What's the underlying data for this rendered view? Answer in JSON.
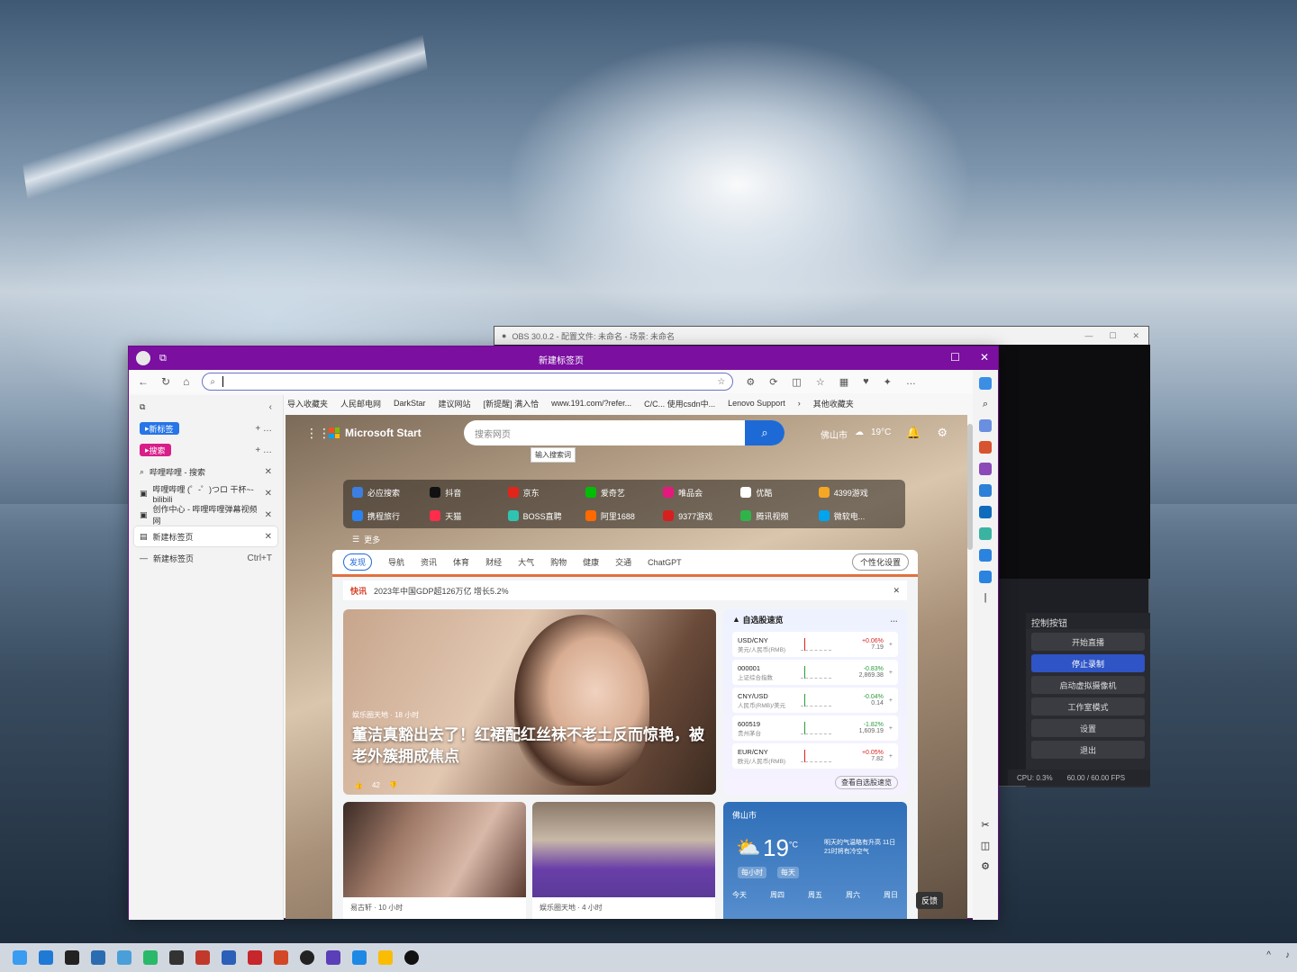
{
  "obs": {
    "title": "OBS 30.0.2 - 配置文件: 未命名 - 场景: 未命名",
    "controls_title": "控制按钮",
    "buttons": [
      "开始直播",
      "停止录制",
      "启动虚拟摄像机",
      "工作室模式",
      "设置",
      "退出"
    ],
    "status_cpu": "CPU: 0.3%",
    "status_fps": "60.00 / 60.00 FPS"
  },
  "browser": {
    "tab_title": "新建标签页",
    "address_value": "",
    "bookmarks": [
      "导入收藏夹",
      "人民邮电网",
      "DarkStar",
      "建议网站",
      "[新提醒] 满入恰",
      "www.191.com/?refer...",
      "C/C... 使用csdn中...",
      "Lenovo Support",
      "其他收藏夹"
    ],
    "side_tabs": {
      "group1": "新标签",
      "group2": "搜索",
      "tabs": [
        {
          "title": "哔哩哔哩 - 搜索"
        },
        {
          "title": "哔哩哔哩 (゜-゜)つロ 干杯~-bilibili"
        },
        {
          "title": "创作中心 - 哔哩哔哩弹幕视频网"
        },
        {
          "title": "新建标签页"
        }
      ],
      "new_tab_label": "新建标签页",
      "new_tab_shortcut": "Ctrl+T"
    }
  },
  "msn": {
    "brand": "Microsoft Start",
    "search_placeholder": "搜索网页",
    "tooltip": "输入搜索词",
    "location": "佛山市",
    "temp_top": "19°C",
    "notif_count": "1",
    "quicklinks": [
      "必应搜索",
      "抖音",
      "京东",
      "爱奇艺",
      "唯品会",
      "优酷",
      "4399游戏",
      "携程旅行",
      "天猫",
      "BOSS直聘",
      "阿里1688",
      "9377游戏",
      "腾讯视频",
      "微软电...",
      "更多"
    ],
    "feed_tabs": [
      "发现",
      "导航",
      "资讯",
      "体育",
      "财经",
      "大气",
      "购物",
      "健康",
      "交通",
      "ChatGPT"
    ],
    "personalize": "个性化设置",
    "flash_tag": "快讯",
    "flash_text": "2023年中国GDP超126万亿 增长5.2%",
    "hero": {
      "source": "娱乐圈天地 · 18 小时",
      "title": "董洁真豁出去了！红裙配红丝袜不老土反而惊艳，被老外簇拥成焦点",
      "likes": "42"
    },
    "stocks": {
      "title": "自选股速览",
      "rows": [
        {
          "code": "USD/CNY",
          "name": "美元/人民币(RMB)",
          "chg": "+0.06%",
          "price": "7.19",
          "up": false
        },
        {
          "code": "000001",
          "name": "上证综合指数",
          "chg": "-0.83%",
          "price": "2,869.38",
          "up": true
        },
        {
          "code": "CNY/USD",
          "name": "人民币(RMB)/美元",
          "chg": "-0.04%",
          "price": "0.14",
          "up": true
        },
        {
          "code": "600519",
          "name": "贵州茅台",
          "chg": "-1.82%",
          "price": "1,609.19",
          "up": true
        },
        {
          "code": "EUR/CNY",
          "name": "欧元/人民币(RMB)",
          "chg": "+0.05%",
          "price": "7.82",
          "up": false
        }
      ],
      "footer": "查看自选股速览"
    },
    "cards": [
      {
        "source": "易古轩 · 10 小时"
      },
      {
        "source": "娱乐圈天地 · 4 小时"
      }
    ],
    "weather": {
      "city": "佛山市",
      "temp": "19",
      "unit": "°C",
      "note": "明天的气温略有升高 11日21时将有冷空气",
      "tab1": "每小时",
      "tab2": "每天",
      "days": [
        "今天",
        "周四",
        "周五",
        "周六",
        "周日"
      ]
    },
    "feedback": "反馈"
  },
  "colors": {
    "browser_title": "#7a0fa0",
    "search_btn": "#1d6ad6",
    "obs_active": "#2e54c5"
  }
}
